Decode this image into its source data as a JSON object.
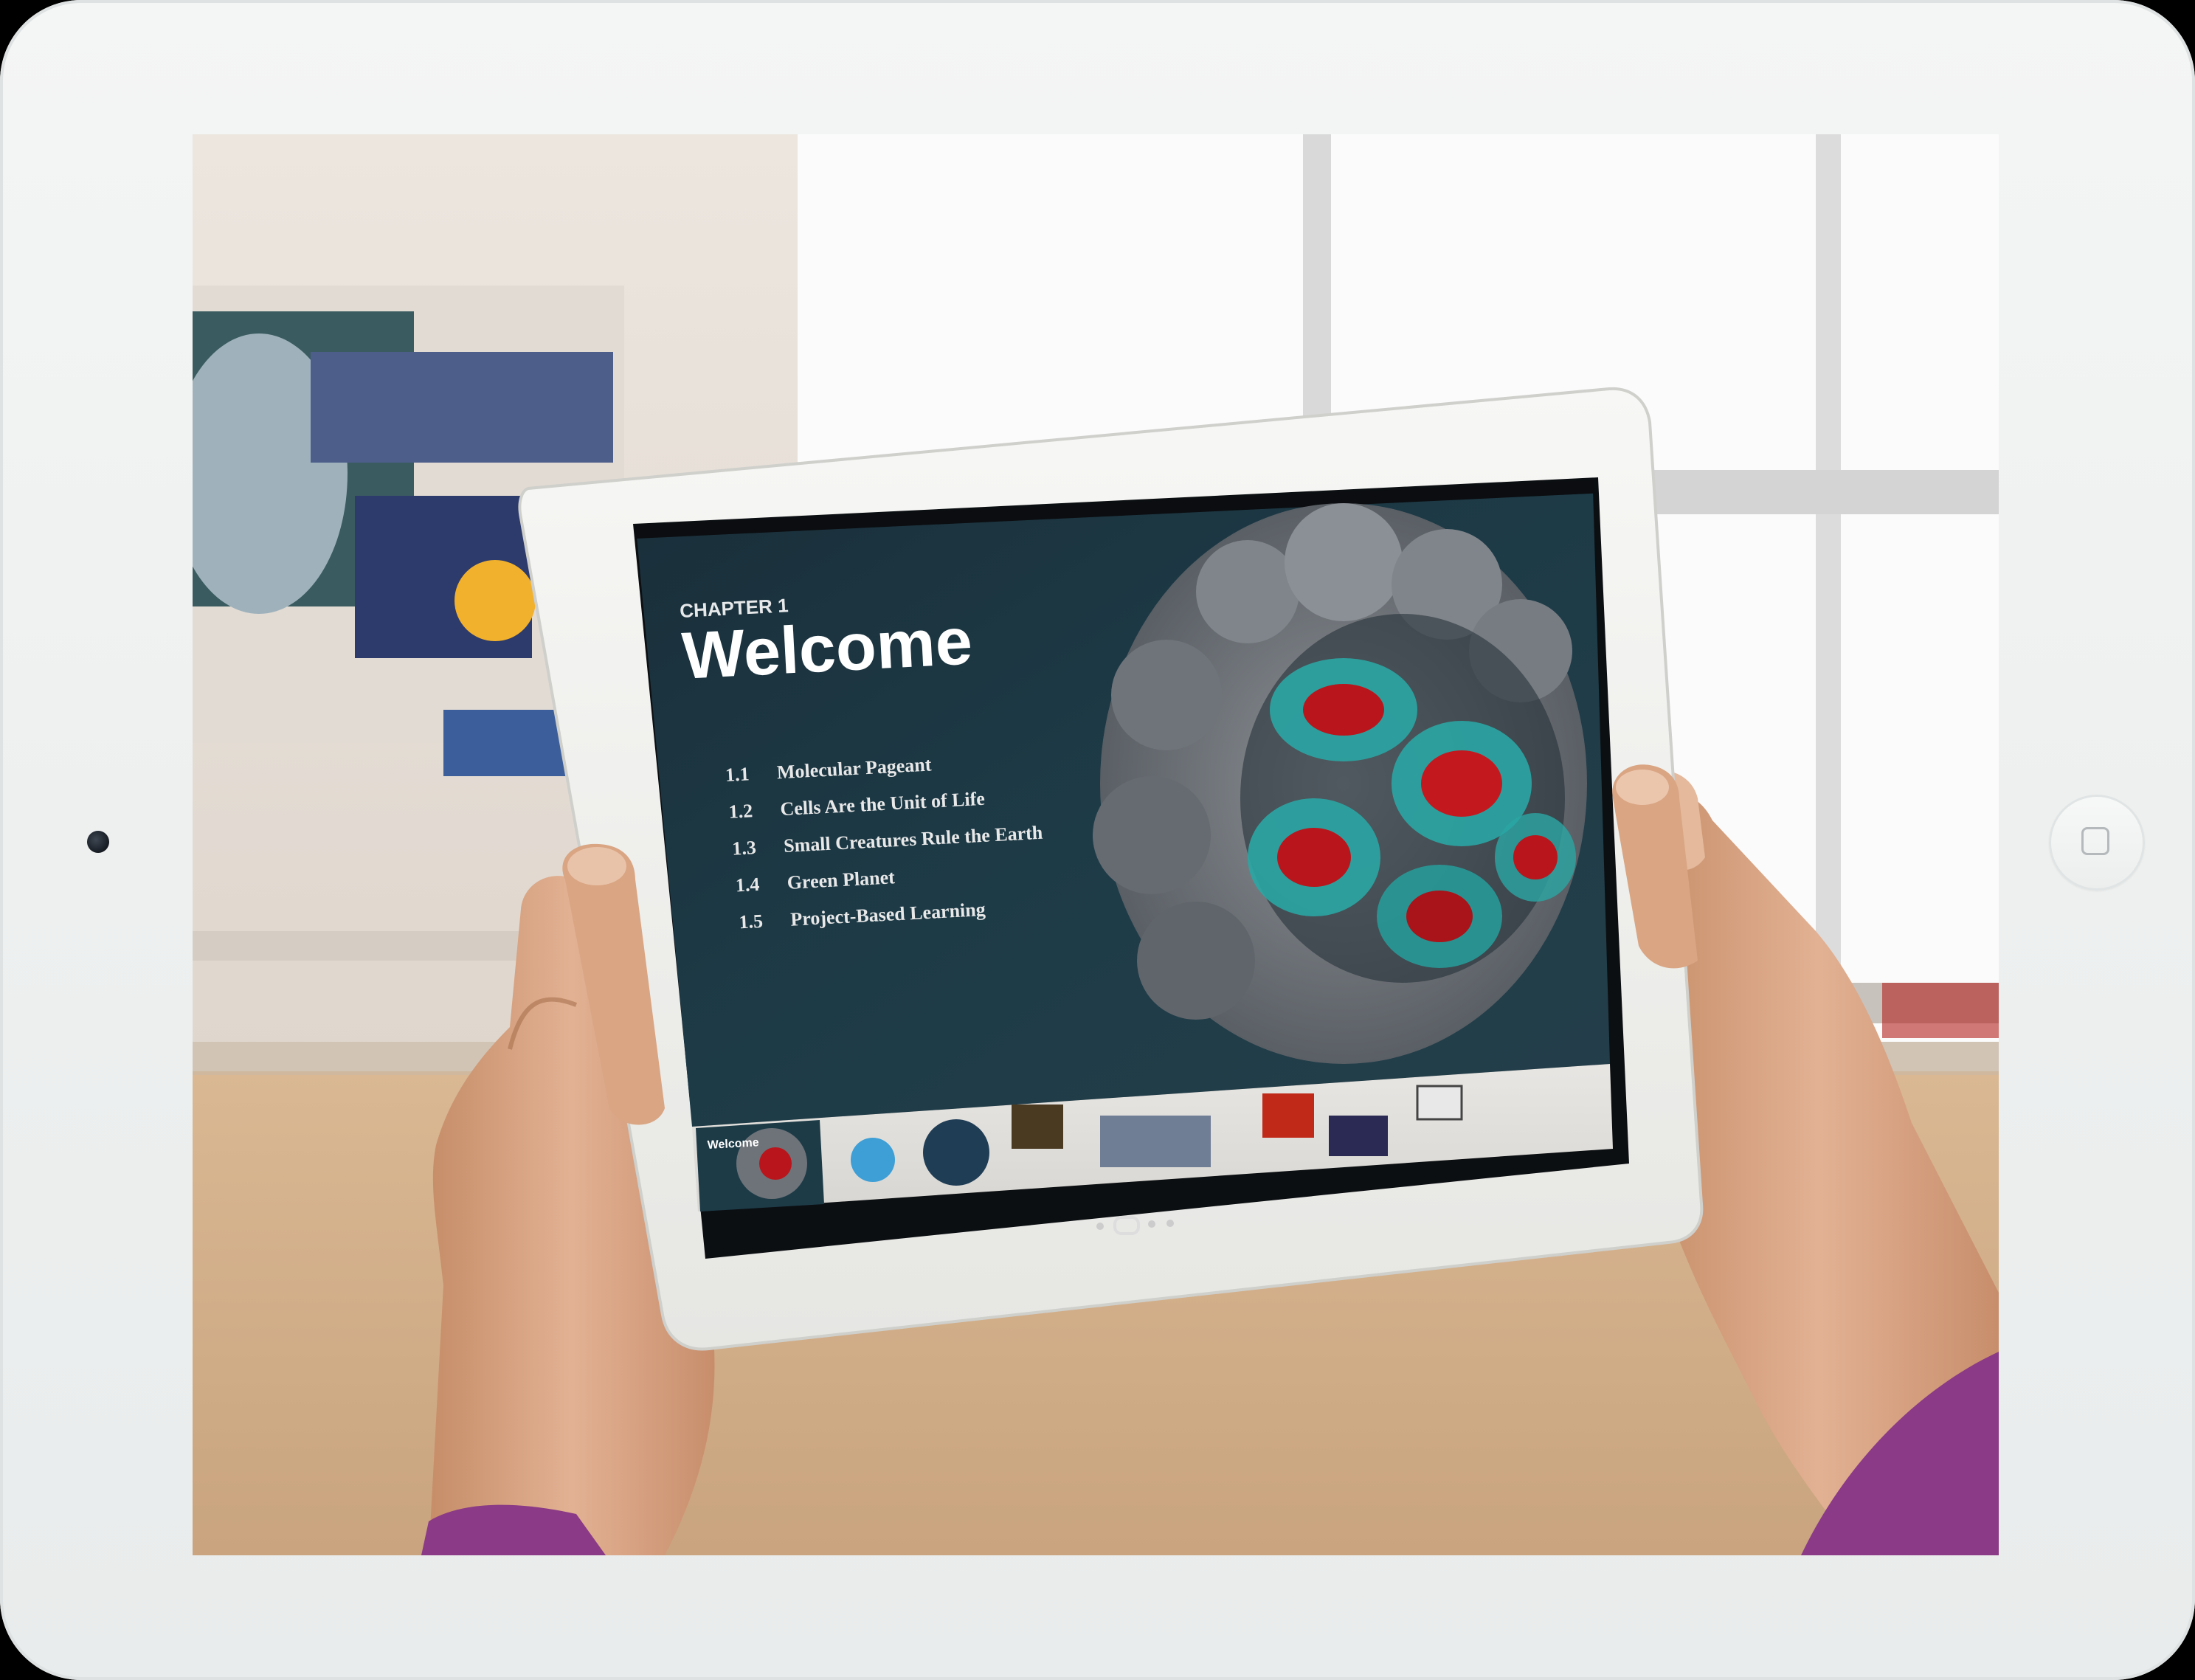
{
  "book": {
    "chapter_label": "CHAPTER 1",
    "title": "Welcome",
    "sections": [
      {
        "number": "1.1",
        "title": "Molecular Pageant"
      },
      {
        "number": "1.2",
        "title": "Cells Are the Unit of Life"
      },
      {
        "number": "1.3",
        "title": "Small Creatures Rule the Earth"
      },
      {
        "number": "1.4",
        "title": "Green Planet"
      },
      {
        "number": "1.5",
        "title": "Project-Based Learning"
      }
    ],
    "thumbnail_title": "Welcome"
  },
  "colors": {
    "frame": "#f1f3f3",
    "tablet_bezel": "#f2f2f0",
    "book_background": "#1c3a46",
    "accent_red": "#b8161c",
    "accent_teal": "#2aa6a4",
    "sleeve": "#8a3a86"
  }
}
